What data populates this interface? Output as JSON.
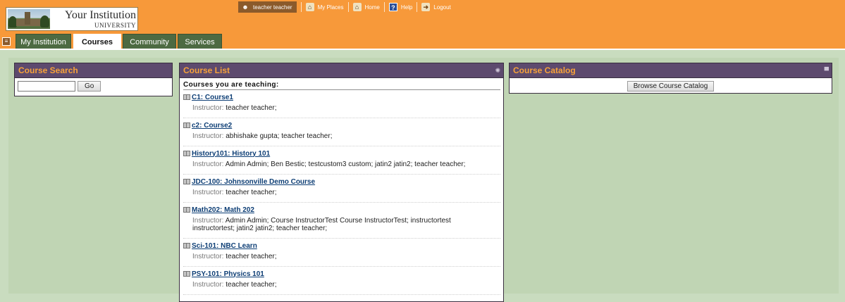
{
  "header": {
    "logo": {
      "title": "Your Institution",
      "subtitle": "UNIVERSITY"
    },
    "topnav": {
      "user": "teacher teacher",
      "my_places": "My Places",
      "home": "Home",
      "help": "Help",
      "logout": "Logout"
    },
    "tabs": [
      {
        "label": "My Institution"
      },
      {
        "label": "Courses"
      },
      {
        "label": "Community"
      },
      {
        "label": "Services"
      }
    ]
  },
  "course_search": {
    "title": "Course Search",
    "input_value": "",
    "go_label": "Go"
  },
  "course_list": {
    "title": "Course List",
    "heading": "Courses you are teaching:",
    "instructor_label": "Instructor:",
    "courses": [
      {
        "link": "C1: Course1",
        "instructors": "teacher teacher;"
      },
      {
        "link": "c2: Course2",
        "instructors": "abhishake gupta;  teacher teacher;"
      },
      {
        "link": "History101: History 101",
        "instructors": "Admin Admin;  Ben Bestic;  testcustom3 custom;  jatin2 jatin2;  teacher teacher;"
      },
      {
        "link": "JDC-100: Johnsonville Demo Course",
        "instructors": "teacher teacher;"
      },
      {
        "link": "Math202: Math 202",
        "instructors": "Admin Admin;  Course InstructorTest Course InstructorTest;  instructortest instructortest;  jatin2 jatin2;  teacher teacher;"
      },
      {
        "link": "Sci-101: NBC Learn",
        "instructors": "teacher teacher;"
      },
      {
        "link": "PSY-101: Physics 101",
        "instructors": "teacher teacher;"
      }
    ]
  },
  "course_catalog": {
    "title": "Course Catalog",
    "browse_label": "Browse Course Catalog"
  },
  "colors": {
    "header_orange": "#f7993a",
    "tab_green": "#4d6a42",
    "module_header_purple": "#5d4a6e",
    "module_title_orange": "#f7a23a",
    "link_blue": "#0d3e75",
    "content_bg": "#c9dcbf"
  }
}
